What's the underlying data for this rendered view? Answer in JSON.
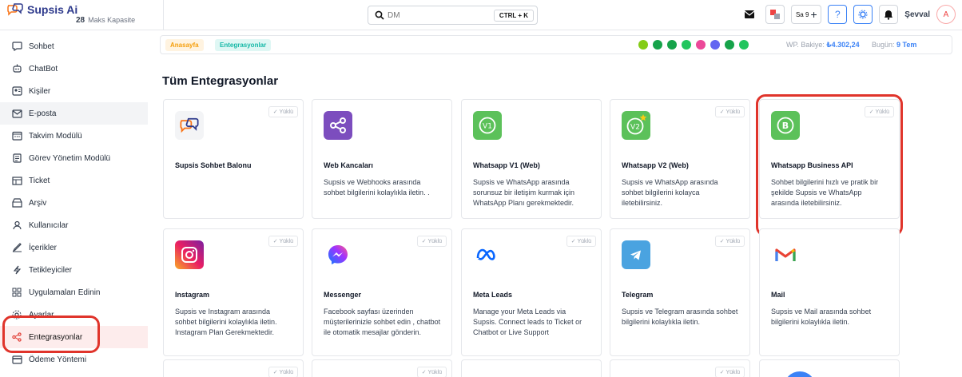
{
  "app": {
    "name": "Supsis Ai",
    "capacity_num": "28",
    "capacity_label": "Maks Kapasite"
  },
  "search": {
    "placeholder": "DM",
    "shortcut": "CTRL + K"
  },
  "topbar": {
    "icons": [
      "mail-icon",
      "translate-icon",
      "add-icon",
      "help-icon",
      "settings-icon",
      "bell-icon"
    ],
    "badge_text": "Sa 9",
    "user": "Şevval",
    "avatar": "A"
  },
  "sidebar": {
    "items": [
      {
        "label": "Sohbet",
        "icon": "chat-icon"
      },
      {
        "label": "ChatBot",
        "icon": "bot-icon"
      },
      {
        "label": "Kişiler",
        "icon": "contacts-icon"
      },
      {
        "label": "E-posta",
        "icon": "mail-icon"
      },
      {
        "label": "Takvim Modülü",
        "icon": "calendar-icon"
      },
      {
        "label": "Görev Yönetim Modülü",
        "icon": "task-icon"
      },
      {
        "label": "Ticket",
        "icon": "ticket-icon"
      },
      {
        "label": "Arşiv",
        "icon": "archive-icon"
      },
      {
        "label": "Kullanıcılar",
        "icon": "users-icon"
      },
      {
        "label": "İçerikler",
        "icon": "content-icon"
      },
      {
        "label": "Tetikleyiciler",
        "icon": "trigger-icon"
      },
      {
        "label": "Uygulamaları Edinin",
        "icon": "apps-icon"
      },
      {
        "label": "Ayarlar",
        "icon": "settings-icon"
      },
      {
        "label": "Entegrasyonlar",
        "icon": "integrations-icon"
      },
      {
        "label": "Ödeme Yöntemi",
        "icon": "payment-icon"
      }
    ]
  },
  "breadcrumb": {
    "home": "Anasayfa",
    "current": "Entegrasyonlar"
  },
  "wallet": {
    "label": "WP. Bakiye:",
    "value": "₺4.302,24",
    "today_label": "Bugün:",
    "today_value": "9 Tem"
  },
  "page_title": "Tüm Entegrasyonlar",
  "installed_label": "✓ Yüklü",
  "cards": [
    {
      "title": "Supsis Sohbet Balonu",
      "desc": "",
      "icon": "supsis-bubble-icon"
    },
    {
      "title": "Web Kancaları",
      "desc": "Supsis ve Webhooks arasında sohbet bilgilerini kolaylıkla iletin. .",
      "icon": "webhook-icon"
    },
    {
      "title": "Whatsapp V1 (Web)",
      "desc": "Supsis ve WhatsApp arasında sorunsuz bir iletişim kurmak için WhatsApp Planı gerekmektedir.",
      "icon": "whatsapp-v1-icon"
    },
    {
      "title": "Whatsapp V2 (Web)",
      "desc": "Supsis ve WhatsApp arasında sohbet bilgilerini kolayca iletebilirsiniz.",
      "icon": "whatsapp-v2-icon"
    },
    {
      "title": "Whatsapp Business API",
      "desc": "Sohbet bilgilerini hızlı ve pratik bir şekilde Supsis ve WhatsApp arasında iletebilirsiniz.",
      "icon": "whatsapp-business-icon"
    },
    {
      "title": "Instagram",
      "desc": "Supsis ve Instagram arasında sohbet bilgilerini kolaylıkla iletin. Instagram Plan Gerekmektedir.",
      "icon": "instagram-icon"
    },
    {
      "title": "Messenger",
      "desc": "Facebook sayfası üzerinden müşterilerinizle sohbet edin , chatbot ile otomatik mesajlar gönderin.",
      "icon": "messenger-icon"
    },
    {
      "title": "Meta Leads",
      "desc": "Manage your Meta Leads via Supsis. Connect leads to Ticket or Chatbot or Live Support",
      "icon": "meta-icon"
    },
    {
      "title": "Telegram",
      "desc": "Supsis ve Telegram arasında sohbet bilgilerini kolaylıkla iletin.",
      "icon": "telegram-icon"
    },
    {
      "title": "Mail",
      "desc": "Supsis ve Mail arasında sohbet bilgilerini kolaylıkla iletin.",
      "icon": "gmail-icon"
    }
  ],
  "colors": {
    "brand": "#2e3a8c",
    "highlight": "#e0342b",
    "whatsapp": "#5cc15a",
    "webhook": "#7c4dbe",
    "telegram": "#4aa3e0"
  }
}
